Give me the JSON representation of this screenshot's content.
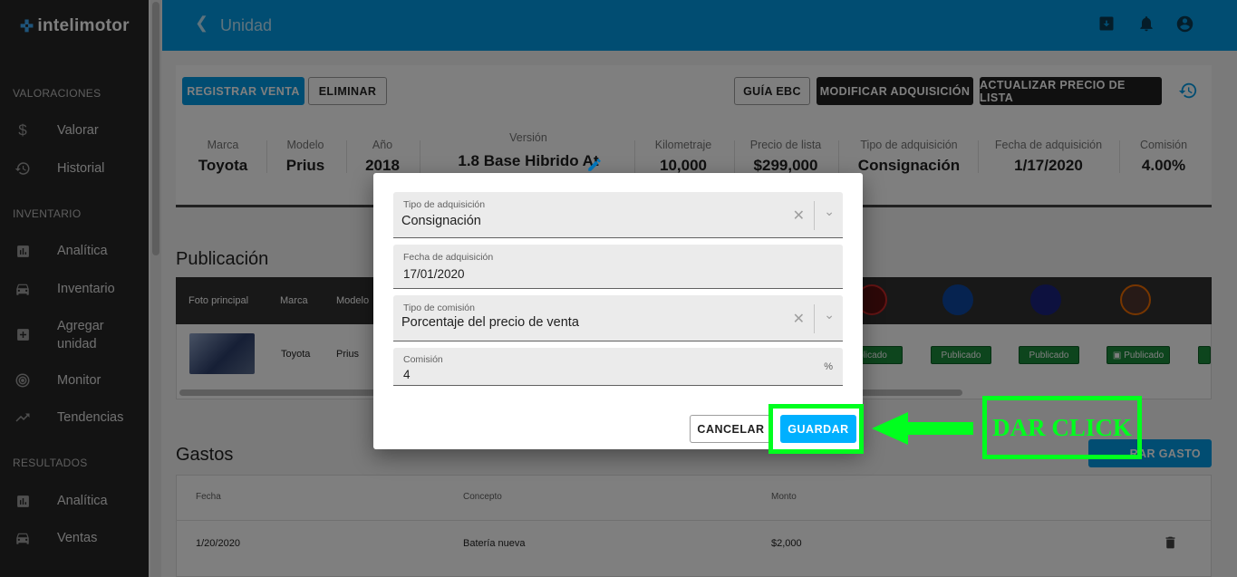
{
  "app": {
    "logo": "intelimotor"
  },
  "sidebar": {
    "sections": [
      {
        "label": "VALORACIONES"
      },
      {
        "label": "INVENTARIO"
      },
      {
        "label": "RESULTADOS"
      }
    ],
    "items": [
      {
        "label": "Valorar",
        "icon": "dollar-icon"
      },
      {
        "label": "Historial",
        "icon": "history-icon"
      },
      {
        "label": "Analítica",
        "icon": "chart-icon"
      },
      {
        "label": "Inventario",
        "icon": "car-icon"
      },
      {
        "label": "Agregar unidad",
        "icon": "add-box-icon"
      },
      {
        "label": "Monitor",
        "icon": "radar-icon"
      },
      {
        "label": "Tendencias",
        "icon": "trending-icon"
      },
      {
        "label": "Analítica",
        "icon": "chart-icon"
      },
      {
        "label": "Ventas",
        "icon": "car-icon"
      }
    ]
  },
  "header": {
    "title": "Unidad",
    "back_icon": "chevron-left-icon"
  },
  "toolbar": {
    "register_sale": "REGISTRAR VENTA",
    "delete": "ELIMINAR",
    "guide": "GUÍA EBC",
    "modify_acquisition": "MODIFICAR ADQUISICIÓN",
    "update_price": "ACTUALIZAR PRECIO DE LISTA"
  },
  "summary": [
    {
      "label": "Marca",
      "value": "Toyota"
    },
    {
      "label": "Modelo",
      "value": "Prius"
    },
    {
      "label": "Año",
      "value": "2018"
    },
    {
      "label": "Versión",
      "value": "1.8 Base Hibrido At"
    },
    {
      "label": "Kilometraje",
      "value": "10,000"
    },
    {
      "label": "Precio de lista",
      "value": "$299,000"
    },
    {
      "label": "Tipo de adquisición",
      "value": "Consignación"
    },
    {
      "label": "Fecha de adquisición",
      "value": "1/17/2020"
    },
    {
      "label": "Comisión",
      "value": "4.00%"
    }
  ],
  "publicacion": {
    "title": "Publicación",
    "columns": [
      "Foto principal",
      "Marca",
      "Modelo"
    ],
    "row": {
      "marca": "Toyota",
      "modelo": "Prius"
    },
    "status": "Publicado",
    "status_partial": "blicado"
  },
  "gastos": {
    "title": "Gastos",
    "add_button_partial": "RAR GASTO",
    "columns": [
      "Fecha",
      "Concepto",
      "Monto"
    ],
    "rows": [
      {
        "fecha": "1/20/2020",
        "concepto": "Batería nueva",
        "monto": "$2,000"
      }
    ]
  },
  "modal": {
    "acquisition_type": {
      "label": "Tipo de adquisición",
      "value": "Consignación"
    },
    "acquisition_date": {
      "label": "Fecha de adquisición",
      "value": "17/01/2020"
    },
    "commission_type": {
      "label": "Tipo de comisión",
      "value": "Porcentaje del precio de venta"
    },
    "commission": {
      "label": "Comisión",
      "value": "4",
      "unit": "%"
    },
    "cancel": "CANCELAR",
    "save": "GUARDAR"
  },
  "annotation": {
    "text": "DAR CLICK",
    "color": "#00ff1e"
  },
  "colors": {
    "header": "#039be5",
    "sidebar": "#262626",
    "accent": "#00b0ff"
  }
}
